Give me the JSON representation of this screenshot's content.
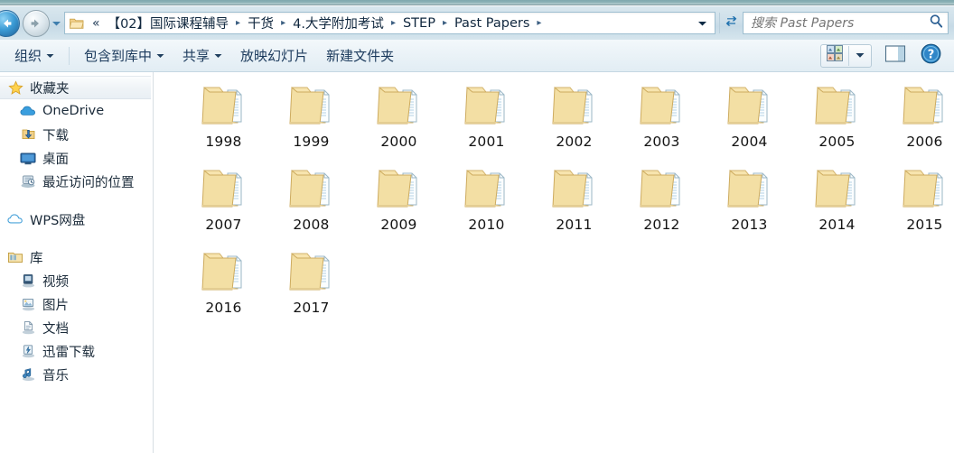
{
  "window": {
    "title_strip_color": "#89b0b5",
    "accent_color": "#1d5e95"
  },
  "navbar": {
    "back_icon": "back-arrow-icon",
    "forward_icon": "forward-arrow-icon",
    "history_dropdown_icon": "chevron-down-icon",
    "address_folder_icon": "folder-icon",
    "overflow": "«",
    "separator": "▸",
    "breadcrumbs": [
      "【02】国际课程辅导",
      "干货",
      "4.大学附加考试",
      "STEP",
      "Past Papers"
    ],
    "address_caret_icon": "chevron-down-icon",
    "refresh_icon": "refresh-icon",
    "search": {
      "placeholder": "搜索 Past Papers",
      "value": "",
      "icon": "search-icon"
    }
  },
  "toolbar": {
    "items": [
      {
        "label": "组织",
        "has_caret": true
      },
      {
        "label": "包含到库中",
        "has_caret": true
      },
      {
        "label": "共享",
        "has_caret": true
      },
      {
        "label": "放映幻灯片",
        "has_caret": false
      },
      {
        "label": "新建文件夹",
        "has_caret": false
      }
    ],
    "view_button_icon": "view-options-icon",
    "view_caret_icon": "chevron-down-icon",
    "preview_pane_icon": "preview-pane-icon",
    "help_icon": "help-icon"
  },
  "sidebar": {
    "items": [
      {
        "label": "收藏夹",
        "icon": "star-icon",
        "level": "section",
        "selected": true
      },
      {
        "label": "OneDrive",
        "icon": "onedrive-cloud-icon",
        "level": "child",
        "selected": false
      },
      {
        "label": "下载",
        "icon": "downloads-icon",
        "level": "child",
        "selected": false
      },
      {
        "label": "桌面",
        "icon": "desktop-icon",
        "level": "child",
        "selected": false
      },
      {
        "label": "最近访问的位置",
        "icon": "recent-places-icon",
        "level": "child",
        "selected": false
      },
      {
        "label": "WPS网盘",
        "icon": "wps-cloud-icon",
        "level": "section",
        "selected": false
      },
      {
        "label": "库",
        "icon": "library-icon",
        "level": "section",
        "selected": false
      },
      {
        "label": "视频",
        "icon": "video-icon",
        "level": "child",
        "selected": false
      },
      {
        "label": "图片",
        "icon": "pictures-icon",
        "level": "child",
        "selected": false
      },
      {
        "label": "文档",
        "icon": "documents-icon",
        "level": "child",
        "selected": false
      },
      {
        "label": "迅雷下载",
        "icon": "thunder-download-icon",
        "level": "child",
        "selected": false
      },
      {
        "label": "音乐",
        "icon": "music-icon",
        "level": "child",
        "selected": false
      }
    ]
  },
  "content": {
    "view_mode": "large-icons",
    "folders": [
      {
        "name": "1998",
        "icon": "folder-icon"
      },
      {
        "name": "1999",
        "icon": "folder-icon"
      },
      {
        "name": "2000",
        "icon": "folder-icon"
      },
      {
        "name": "2001",
        "icon": "folder-icon"
      },
      {
        "name": "2002",
        "icon": "folder-icon"
      },
      {
        "name": "2003",
        "icon": "folder-icon"
      },
      {
        "name": "2004",
        "icon": "folder-icon"
      },
      {
        "name": "2005",
        "icon": "folder-icon"
      },
      {
        "name": "2006",
        "icon": "folder-icon"
      },
      {
        "name": "2007",
        "icon": "folder-icon"
      },
      {
        "name": "2008",
        "icon": "folder-icon"
      },
      {
        "name": "2009",
        "icon": "folder-icon"
      },
      {
        "name": "2010",
        "icon": "folder-icon"
      },
      {
        "name": "2011",
        "icon": "folder-icon"
      },
      {
        "name": "2012",
        "icon": "folder-icon"
      },
      {
        "name": "2013",
        "icon": "folder-icon"
      },
      {
        "name": "2014",
        "icon": "folder-icon"
      },
      {
        "name": "2015",
        "icon": "folder-icon"
      },
      {
        "name": "2016",
        "icon": "folder-icon"
      },
      {
        "name": "2017",
        "icon": "folder-icon"
      }
    ]
  }
}
